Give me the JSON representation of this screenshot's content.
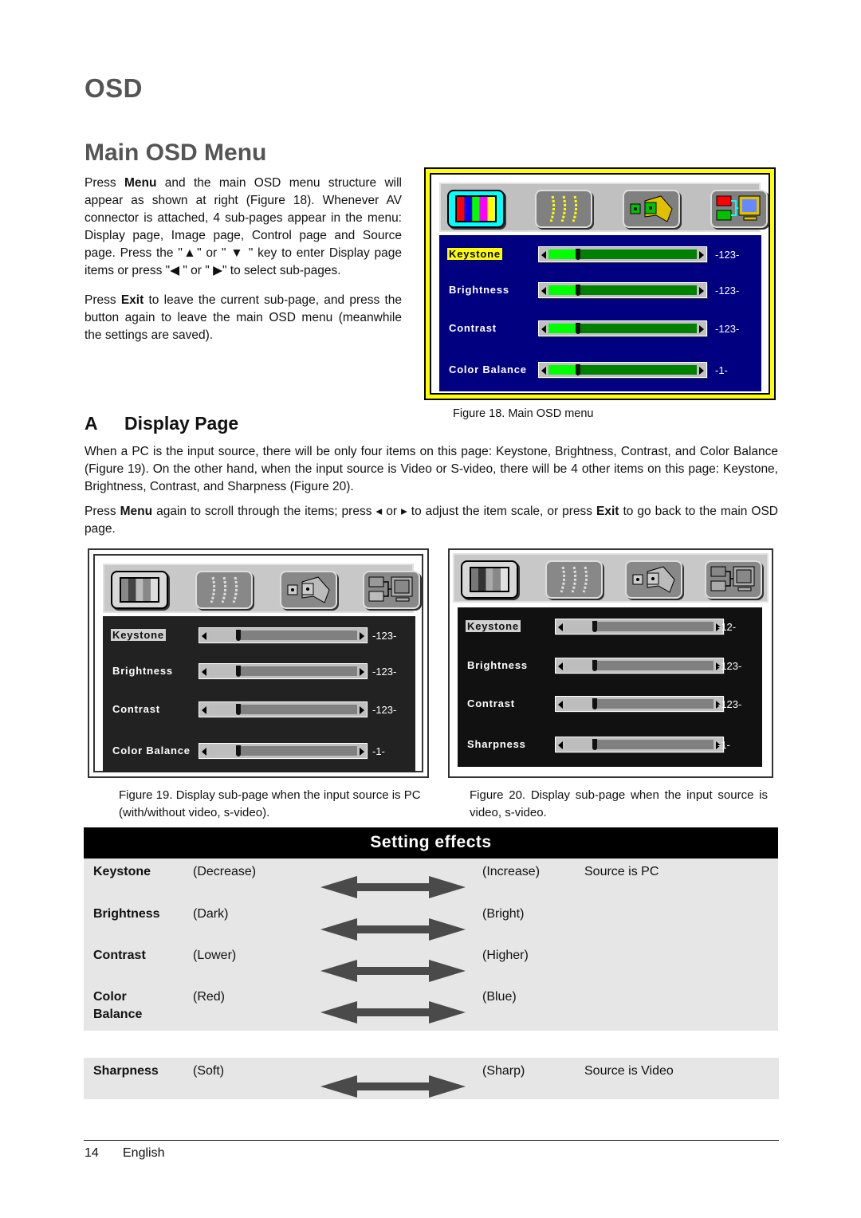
{
  "headings": {
    "section": "OSD",
    "subsection": "Main OSD Menu",
    "display_letter": "A",
    "display_title": "Display Page"
  },
  "intro": {
    "p1_pre": "Press ",
    "p1_bold": "Menu",
    "p1_post": " and the main OSD menu structure will appear as shown at right (Figure 18). Whenever AV connector is attached, 4 sub-pages appear in the menu: Display page, Image page, Control page and Source page. Press the \"▲\" or \" ▼ \" key to enter Display page items or press \"◀ \" or \"  ▶\" to select sub-pages.",
    "p2_pre": "Press ",
    "p2_bold": "Exit",
    "p2_post": " to leave the current sub-page, and press the button again to leave the main OSD menu (meanwhile the settings are saved)."
  },
  "display_page": {
    "p1": "When a PC is the input source, there will be only four items on this page: Keystone, Brightness, Contrast, and Color Balance (Figure 19). On the other hand, when the input source is Video or S-video, there will be 4 other items on this page: Keystone, Brightness, Contrast, and Sharpness (Figure 20).",
    "p2_a": "Press ",
    "p2_b": "Menu",
    "p2_c": " again to scroll through the items; press ◂ or ▸ to adjust the item scale, or press ",
    "p2_d": "Exit",
    "p2_e": " to go back to the main OSD page."
  },
  "figures": {
    "fig18": {
      "caption": "Figure 18. Main OSD menu",
      "tabs": [
        "display-page-icon",
        "image-page-icon",
        "control-page-icon",
        "source-page-icon"
      ],
      "selected_tab": 0,
      "rows": [
        {
          "label": "Keystone",
          "value": "-123-",
          "level": 0.2,
          "highlighted": true
        },
        {
          "label": "Brightness",
          "value": "-123-",
          "level": 0.2,
          "highlighted": false
        },
        {
          "label": "Contrast",
          "value": "-123-",
          "level": 0.2,
          "highlighted": false
        },
        {
          "label": "Color Balance",
          "value": "-1-",
          "level": 0.2,
          "highlighted": false
        }
      ],
      "colors": {
        "frame": "#ffff00",
        "panel": "#000080",
        "track": "#008000",
        "fill": "#00ff00",
        "selected_tab": "#00ffff"
      }
    },
    "fig19": {
      "caption": "Figure 19. Display sub-page when the input source is PC (with/without video, s-video).",
      "rows": [
        {
          "label": "Keystone",
          "value": "-123-",
          "level": 0.2,
          "highlighted": true
        },
        {
          "label": "Brightness",
          "value": "-123-",
          "level": 0.2,
          "highlighted": false
        },
        {
          "label": "Contrast",
          "value": "-123-",
          "level": 0.2,
          "highlighted": false
        },
        {
          "label": "Color Balance",
          "value": "-1-",
          "level": 0.2,
          "highlighted": false
        }
      ]
    },
    "fig20": {
      "caption": "Figure 20. Display sub-page when the input source is video, s-video.",
      "rows": [
        {
          "label": "Keystone",
          "value": "-12-",
          "level": 0.2,
          "highlighted": true
        },
        {
          "label": "Brightness",
          "value": "-123-",
          "level": 0.2,
          "highlighted": false
        },
        {
          "label": "Contrast",
          "value": "-123-",
          "level": 0.2,
          "highlighted": false
        },
        {
          "label": "Sharpness",
          "value": "-1-",
          "level": 0.2,
          "highlighted": false
        }
      ]
    }
  },
  "setting_effects": {
    "title": "Setting effects",
    "rows": [
      {
        "name": "Keystone",
        "low": "(Decrease)",
        "high": "(Increase)",
        "note": "Source is PC"
      },
      {
        "name": "Brightness",
        "low": "(Dark)",
        "high": "(Bright)",
        "note": ""
      },
      {
        "name": "Contrast",
        "low": "(Lower)",
        "high": "(Higher)",
        "note": ""
      },
      {
        "name": "Color Balance",
        "low": "(Red)",
        "high": "(Blue)",
        "note": ""
      }
    ],
    "video_rows": [
      {
        "name": "Sharpness",
        "low": "(Soft)",
        "high": "(Sharp)",
        "note": "Source is Video"
      }
    ]
  },
  "footer": {
    "page_number": "14",
    "language": "English"
  }
}
